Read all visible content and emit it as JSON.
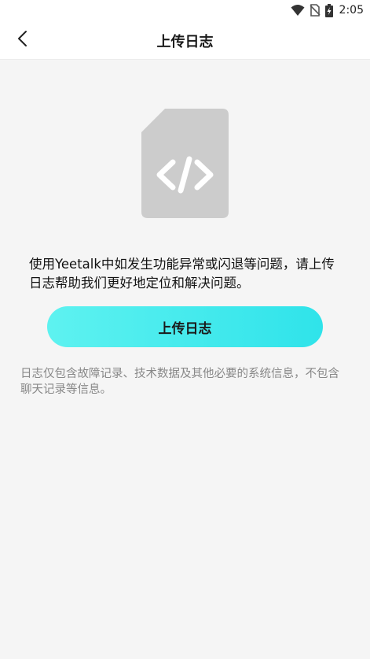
{
  "status_bar": {
    "time": "2:05",
    "icons": [
      "wifi-icon",
      "no-sim-icon",
      "battery-charging-icon"
    ]
  },
  "header": {
    "back_icon": "chevron-left-icon",
    "title": "上传日志"
  },
  "main": {
    "illustration_icon": "code-document-icon",
    "description": "使用Yeetalk中如发生功能异常或闪退等问题，请上传日志帮助我们更好地定位和解决问题。",
    "upload_button_label": "上传日志",
    "note": "日志仅包含故障记录、技术数据及其他必要的系统信息，不包含聊天记录等信息。"
  },
  "colors": {
    "background": "#f5f5f5",
    "button_gradient_start": "#5ef2f0",
    "button_gradient_end": "#2fe3ea",
    "icon_gray": "#cccccc"
  }
}
